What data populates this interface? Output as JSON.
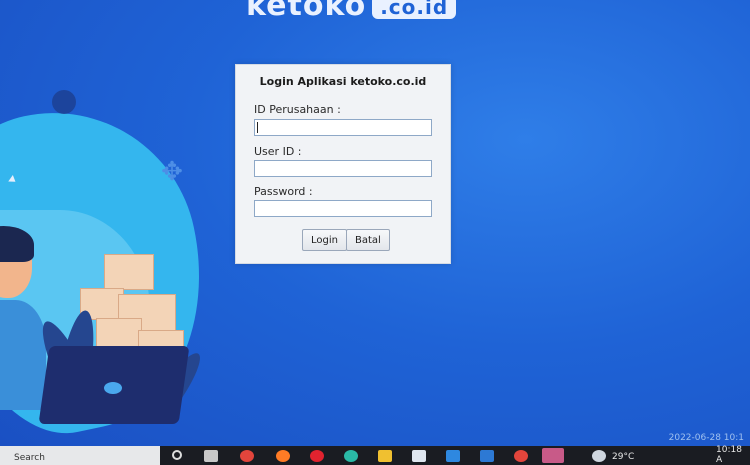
{
  "brand": {
    "name": "ketoko",
    "tld": ".co.id"
  },
  "dialog": {
    "title": "Login Aplikasi ketoko.co.id",
    "fields": {
      "company_id": {
        "label": "ID Perusahaan :",
        "value": ""
      },
      "user_id": {
        "label": "User ID :",
        "value": ""
      },
      "password": {
        "label": "Password :",
        "value": ""
      }
    },
    "buttons": {
      "login": "Login",
      "cancel": "Batal"
    }
  },
  "taskbar": {
    "search_label": "Search",
    "weather": "29°C",
    "clock": "10:18 A",
    "date_stamp": "2022-06-28 10:1",
    "icons": [
      "search-icon",
      "task-view-icon",
      "chrome-icon",
      "firefox-icon",
      "opera-icon",
      "edge-icon",
      "file-explorer-icon",
      "store-icon",
      "mail-icon",
      "photos-icon",
      "chrome-icon",
      "pinned-app-icon",
      "weather-icon"
    ]
  },
  "colors": {
    "accent": "#1f63d6",
    "background": "#2270e0",
    "taskbar": "#1a1c22"
  }
}
